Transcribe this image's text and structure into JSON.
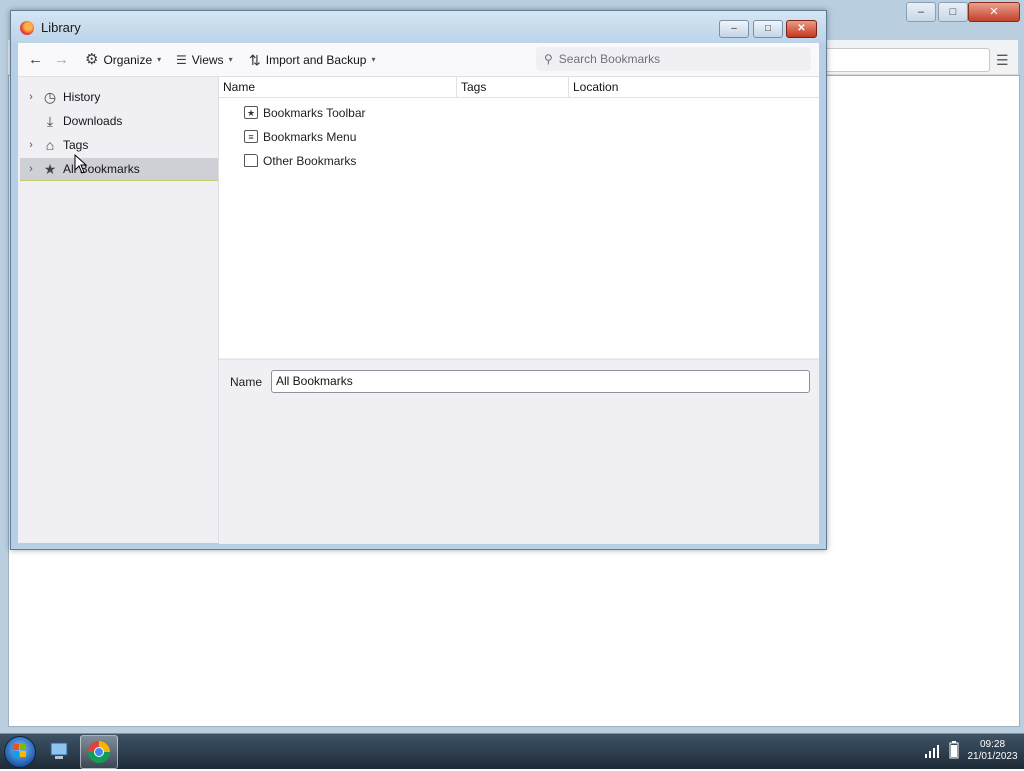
{
  "library_window": {
    "title": "Library",
    "controls": {
      "minimize": "–",
      "maximize": "□",
      "close": "✕"
    }
  },
  "toolbar": {
    "back_icon": "arrow-left-icon",
    "forward_icon": "arrow-right-icon",
    "organize_label": "Organize",
    "views_label": "Views",
    "import_backup_label": "Import and Backup",
    "search_placeholder": "Search Bookmarks"
  },
  "sidebar": {
    "items": [
      {
        "label": "History",
        "icon": "clock-icon",
        "expandable": true,
        "selected": false
      },
      {
        "label": "Downloads",
        "icon": "download-icon",
        "expandable": false,
        "selected": false
      },
      {
        "label": "Tags",
        "icon": "tag-icon",
        "expandable": true,
        "selected": false
      },
      {
        "label": "All Bookmarks",
        "icon": "star-icon",
        "expandable": true,
        "selected": true
      }
    ]
  },
  "list": {
    "columns": [
      "Name",
      "Tags",
      "Location"
    ],
    "rows": [
      {
        "name": "Bookmarks Toolbar",
        "icon": "bookmarks-toolbar-icon"
      },
      {
        "name": "Bookmarks Menu",
        "icon": "bookmarks-menu-icon"
      },
      {
        "name": "Other Bookmarks",
        "icon": "folder-icon"
      }
    ]
  },
  "details": {
    "name_label": "Name",
    "name_value": "All Bookmarks"
  },
  "taskbar": {
    "time": "09:28",
    "date": "21/01/2023"
  }
}
